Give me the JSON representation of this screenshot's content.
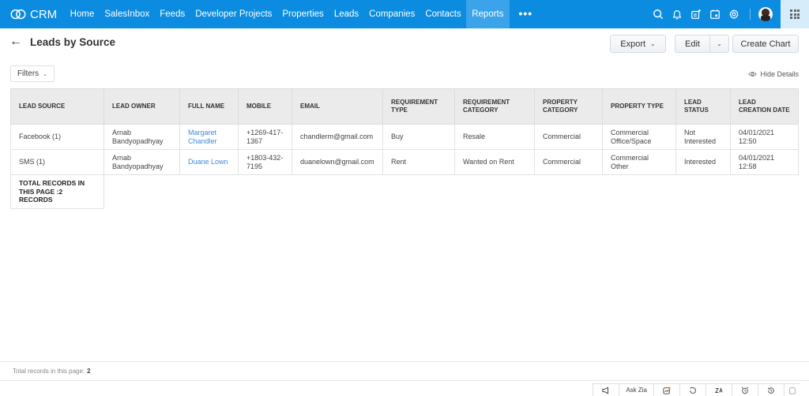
{
  "app": {
    "name": "CRM",
    "nav": [
      {
        "label": "Home",
        "active": false
      },
      {
        "label": "SalesInbox",
        "active": false
      },
      {
        "label": "Feeds",
        "active": false
      },
      {
        "label": "Developer Projects",
        "active": false
      },
      {
        "label": "Properties",
        "active": false
      },
      {
        "label": "Leads",
        "active": false
      },
      {
        "label": "Companies",
        "active": false
      },
      {
        "label": "Contacts",
        "active": false
      },
      {
        "label": "Reports",
        "active": true
      }
    ],
    "more_label": "•••",
    "top_icons": [
      "search-icon",
      "bell-icon",
      "add-note-icon",
      "calendar-icon",
      "gear-icon"
    ],
    "accent_color": "#0b8ce0"
  },
  "page": {
    "back_icon": "←",
    "title": "Leads by Source",
    "filters_label": "Filters",
    "hide_details_label": "Hide Details",
    "buttons": {
      "export": "Export",
      "edit": "Edit",
      "create_chart": "Create Chart"
    }
  },
  "table": {
    "columns": [
      "LEAD SOURCE",
      "LEAD OWNER",
      "FULL NAME",
      "MOBILE",
      "EMAIL",
      "REQUIREMENT TYPE",
      "REQUIREMENT CATEGORY",
      "PROPERTY CATEGORY",
      "PROPERTY TYPE",
      "LEAD STATUS",
      "LEAD CREATION DATE"
    ],
    "rows": [
      {
        "lead_source": "Facebook (1)",
        "lead_owner": "Arnab Bandyopadhyay",
        "full_name": "Margaret Chandler",
        "mobile": "+1269-417-1367",
        "email": "chandlerm@gmail.com",
        "requirement_type": "Buy",
        "requirement_category": "Resale",
        "property_category": "Commercial",
        "property_type": "Commercial Office/Space",
        "lead_status": "Not Interested",
        "lead_creation_date": "04/01/2021 12:50"
      },
      {
        "lead_source": "SMS (1)",
        "lead_owner": "Arnab Bandyopadhyay",
        "full_name": "Duane Lown",
        "mobile": "+1803-432-7195",
        "email": "duanelown@gmail.com",
        "requirement_type": "Rent",
        "requirement_category": "Wanted on Rent",
        "property_category": "Commercial",
        "property_type": "Commercial Other",
        "lead_status": "Interested",
        "lead_creation_date": "04/01/2021 12:58"
      }
    ],
    "total_label": "TOTAL RECORDS IN THIS PAGE :2 RECORDS"
  },
  "footer": {
    "total_text": "Total records in this page:",
    "total_value": "2"
  },
  "bottom_tools": {
    "ask_zia": "Ask Zia"
  }
}
